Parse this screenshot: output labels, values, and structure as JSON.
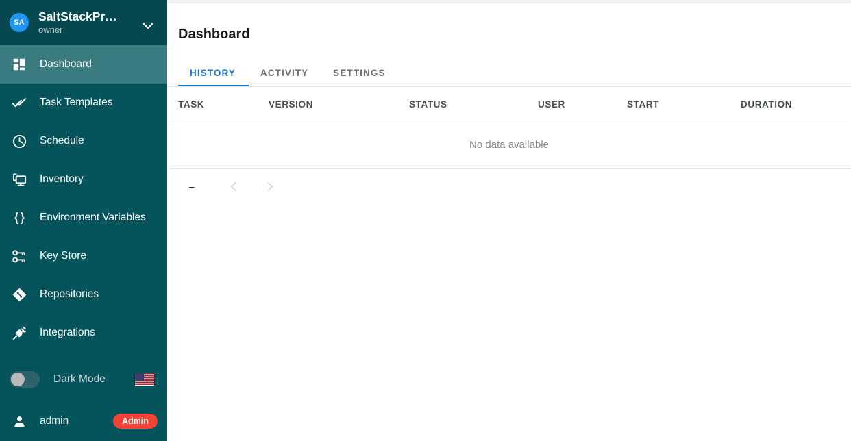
{
  "sidebar": {
    "account": {
      "avatar_initials": "SA",
      "name": "SaltStackPr…",
      "role": "owner",
      "chevron_icon": "chevron-down-icon"
    },
    "items": [
      {
        "label": "Dashboard",
        "icon": "dashboard-grid-icon",
        "active": true
      },
      {
        "label": "Task Templates",
        "icon": "double-check-icon",
        "active": false
      },
      {
        "label": "Schedule",
        "icon": "clock-icon",
        "active": false
      },
      {
        "label": "Inventory",
        "icon": "monitor-icon",
        "active": false
      },
      {
        "label": "Environment Variables",
        "icon": "curly-braces-icon",
        "active": false
      },
      {
        "label": "Key Store",
        "icon": "keys-icon",
        "active": false
      },
      {
        "label": "Repositories",
        "icon": "git-repository-icon",
        "active": false
      },
      {
        "label": "Integrations",
        "icon": "plug-icon",
        "active": false
      }
    ],
    "dark_mode": {
      "label": "Dark Mode",
      "enabled": false
    },
    "language": {
      "flag": "🇺🇸",
      "name": "us-flag-icon"
    },
    "user": {
      "name": "admin",
      "badge": "Admin",
      "icon": "person-icon"
    },
    "scrollbar": {
      "up_icon": "chevron-up-icon",
      "down_icon": "chevron-down-icon"
    }
  },
  "main": {
    "title": "Dashboard",
    "tabs": [
      {
        "label": "HISTORY",
        "active": true
      },
      {
        "label": "ACTIVITY",
        "active": false
      },
      {
        "label": "SETTINGS",
        "active": false
      }
    ],
    "table": {
      "columns": [
        "TASK",
        "VERSION",
        "STATUS",
        "USER",
        "START",
        "DURATION"
      ],
      "rows": [],
      "empty_message": "No data available"
    },
    "pagination": {
      "count_label": "–",
      "prev_icon": "chevron-left-icon",
      "next_icon": "chevron-right-icon"
    }
  },
  "colors": {
    "sidebar_bg": "#05545b",
    "sidebar_header_bg": "#05484f",
    "sidebar_active_bg": "#3a7b80",
    "accent_blue": "#1a73cc",
    "avatar_blue": "#2196f3",
    "badge_red": "#f44336",
    "scrollbar_thumb": "#6b9298"
  }
}
